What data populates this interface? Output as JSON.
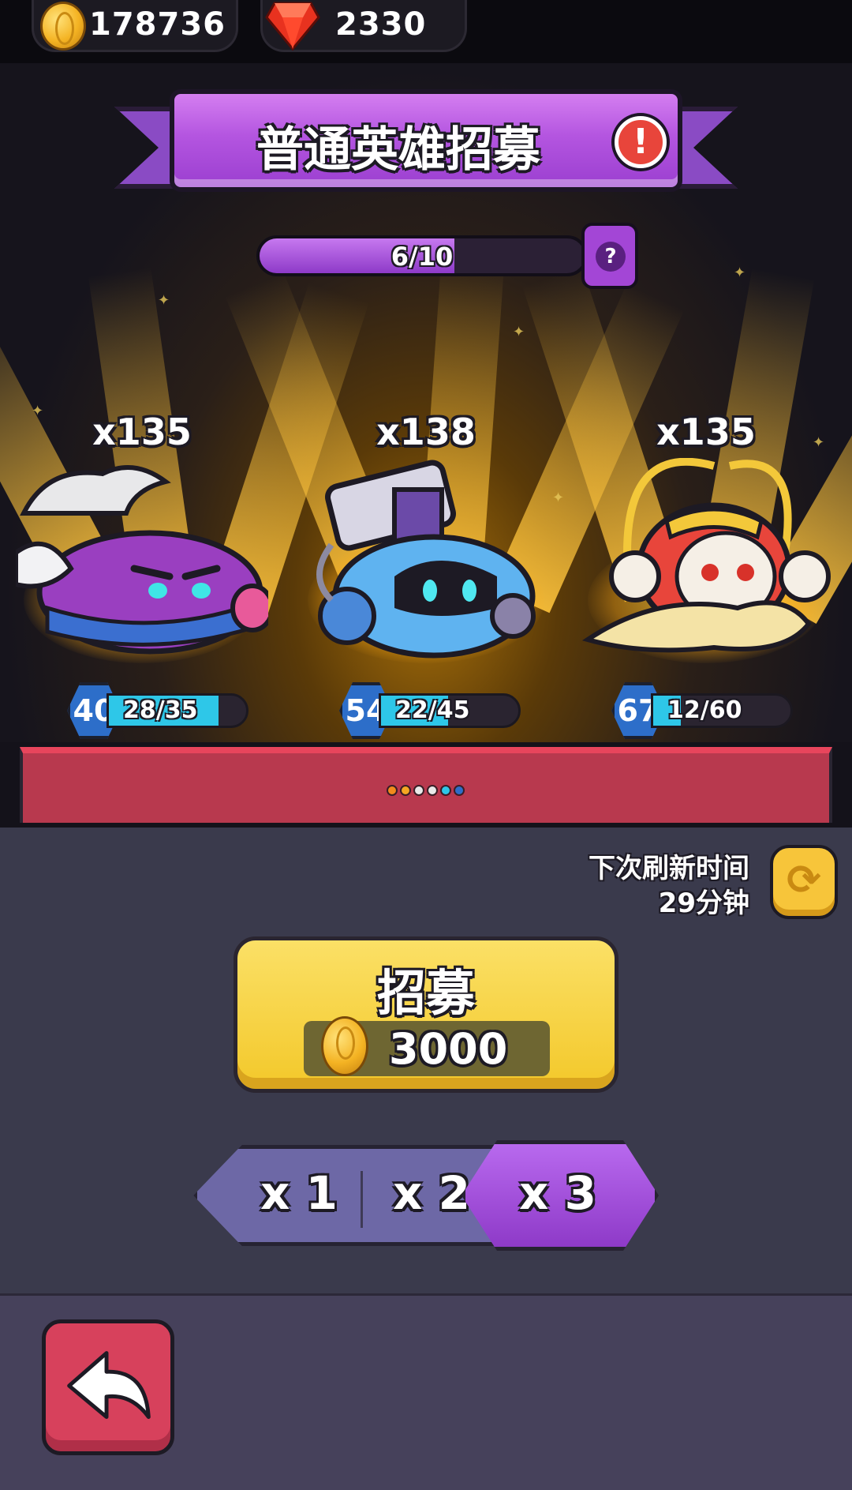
{
  "currencies": {
    "coins": "178736",
    "gems": "2330"
  },
  "title": "普通英雄招募",
  "progress": {
    "text": "6/10",
    "value": 0.6,
    "help_label": "?"
  },
  "heroes": [
    {
      "count": "x135",
      "level": "40",
      "shards": "28/35",
      "shard_fraction": 0.8
    },
    {
      "count": "x138",
      "level": "54",
      "shards": "22/45",
      "shard_fraction": 0.49
    },
    {
      "count": "x135",
      "level": "67",
      "shards": "12/60",
      "shard_fraction": 0.2
    }
  ],
  "page_dots": [
    "#f28a1c",
    "#f5a623",
    "#e9e9e9",
    "#e9e9e9",
    "#2ec7e8",
    "#2d6ec9"
  ],
  "refresh": {
    "label": "下次刷新时间",
    "time": "29分钟"
  },
  "recruit": {
    "label": "招募",
    "cost": "3000"
  },
  "multipliers": {
    "x1": "x 1",
    "x2": "x 2",
    "x3": "x 3",
    "selected": "x 3"
  },
  "colors": {
    "accent_purple": "#9b3fd0",
    "recruit_yellow": "#f3c82a",
    "back_red": "#d7415c",
    "shard_cyan": "#2ec7e8"
  }
}
